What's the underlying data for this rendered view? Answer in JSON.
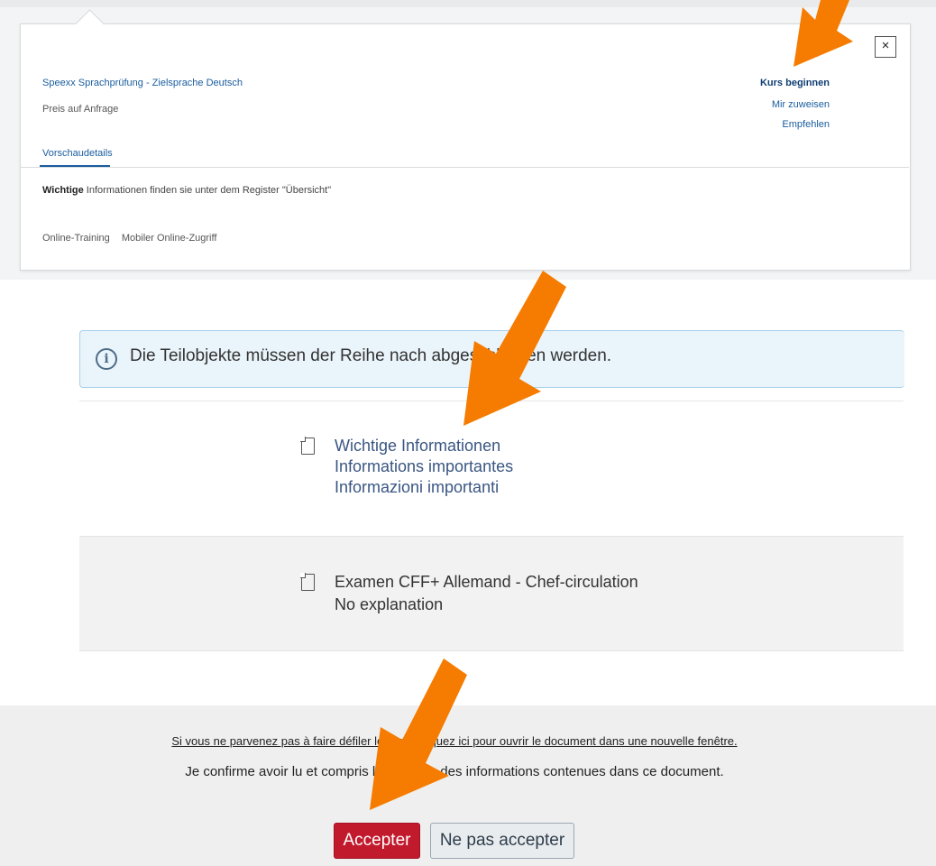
{
  "course_panel": {
    "close_label": "×",
    "title": "Speexx Sprachprüfung - Zielsprache Deutsch",
    "price": "Preis auf Anfrage",
    "actions": {
      "start": "Kurs beginnen",
      "assign": "Mir zuweisen",
      "recommend": "Empfehlen"
    },
    "tab": "Vorschaudetails",
    "info_bold": "Wichtige",
    "info_rest": " Informationen finden sie unter dem Register \"Übersicht\"",
    "features": [
      "Online-Training",
      "Mobiler Online-Zugriff"
    ]
  },
  "notice": {
    "icon": "info-icon",
    "text": "Die Teilobjekte müssen der Reihe nach abgeschlossen werden."
  },
  "items": [
    {
      "icon": "document-icon",
      "lines": [
        "Wichtige Informationen",
        "Informations importantes",
        "Informazioni importanti"
      ]
    },
    {
      "icon": "document-icon",
      "lines": [
        "Examen CFF+ Allemand - Chef-circulation",
        "No explanation"
      ]
    }
  ],
  "footer": {
    "open_link": "Si vous ne parvenez pas à faire défiler le texte, cliquez ici pour ouvrir le document dans une nouvelle fenêtre.",
    "confirm_text": "Je confirme avoir lu et compris l'ensemble des informations contenues dans ce document.",
    "accept_label": "Accepter",
    "decline_label": "Ne pas accepter"
  },
  "colors": {
    "arrow": "#f57c00",
    "accept": "#c21a2d",
    "link": "#1a5d9e"
  }
}
